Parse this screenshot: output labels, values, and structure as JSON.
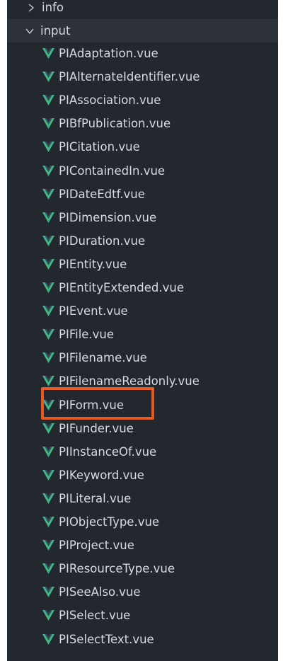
{
  "explorer": {
    "folders": [
      {
        "label": "info",
        "expanded": false
      },
      {
        "label": "input",
        "expanded": true
      }
    ],
    "files": [
      "PIAdaptation.vue",
      "PIAlternateIdentifier.vue",
      "PIAssociation.vue",
      "PIBfPublication.vue",
      "PICitation.vue",
      "PIContainedIn.vue",
      "PIDateEdtf.vue",
      "PIDimension.vue",
      "PIDuration.vue",
      "PIEntity.vue",
      "PIEntityExtended.vue",
      "PIEvent.vue",
      "PIFile.vue",
      "PIFilename.vue",
      "PIFilenameReadonly.vue",
      "PIForm.vue",
      "PIFunder.vue",
      "PIInstanceOf.vue",
      "PIKeyword.vue",
      "PILiteral.vue",
      "PIObjectType.vue",
      "PIProject.vue",
      "PIResourceType.vue",
      "PISeeAlso.vue",
      "PISelect.vue",
      "PISelectText.vue"
    ],
    "highlighted_file": "PIForm.vue",
    "file_icon": "vue-icon",
    "colors": {
      "background": "#23272e",
      "text": "#d7dae0",
      "vue_green": "#41b883",
      "highlight_border": "#e55a23"
    }
  }
}
